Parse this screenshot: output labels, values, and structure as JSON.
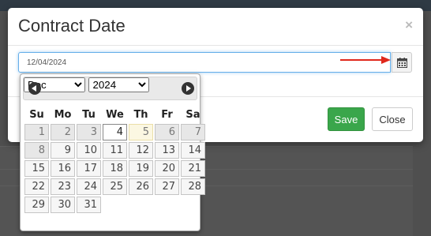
{
  "modal": {
    "title": "Contract Date",
    "close_glyph": "×",
    "date_value": "12/04/2024",
    "calendar_icon": "calendar-icon",
    "save_label": "Save",
    "close_label": "Close"
  },
  "annotation": {
    "arrow_color": "#e0281c"
  },
  "datepicker": {
    "month": "Dec",
    "year": "2024",
    "weekdays": [
      "Su",
      "Mo",
      "Tu",
      "We",
      "Th",
      "Fr",
      "Sa"
    ],
    "weeks": [
      [
        {
          "d": "1",
          "t": "other"
        },
        {
          "d": "2",
          "t": "other"
        },
        {
          "d": "3",
          "t": "other"
        },
        {
          "d": "4",
          "t": "selected"
        },
        {
          "d": "5",
          "t": "today"
        },
        {
          "d": "6",
          "t": "other"
        },
        {
          "d": "7",
          "t": "other"
        }
      ],
      [
        {
          "d": "8",
          "t": "other"
        },
        {
          "d": "9",
          "t": ""
        },
        {
          "d": "10",
          "t": ""
        },
        {
          "d": "11",
          "t": ""
        },
        {
          "d": "12",
          "t": ""
        },
        {
          "d": "13",
          "t": ""
        },
        {
          "d": "14",
          "t": ""
        }
      ],
      [
        {
          "d": "15",
          "t": ""
        },
        {
          "d": "16",
          "t": ""
        },
        {
          "d": "17",
          "t": ""
        },
        {
          "d": "18",
          "t": ""
        },
        {
          "d": "19",
          "t": ""
        },
        {
          "d": "20",
          "t": ""
        },
        {
          "d": "21",
          "t": ""
        }
      ],
      [
        {
          "d": "22",
          "t": ""
        },
        {
          "d": "23",
          "t": ""
        },
        {
          "d": "24",
          "t": ""
        },
        {
          "d": "25",
          "t": ""
        },
        {
          "d": "26",
          "t": ""
        },
        {
          "d": "27",
          "t": ""
        },
        {
          "d": "28",
          "t": ""
        }
      ],
      [
        {
          "d": "29",
          "t": ""
        },
        {
          "d": "30",
          "t": ""
        },
        {
          "d": "31",
          "t": ""
        }
      ]
    ]
  },
  "colors": {
    "save": "#3aa64b",
    "focus": "#66afe9"
  }
}
